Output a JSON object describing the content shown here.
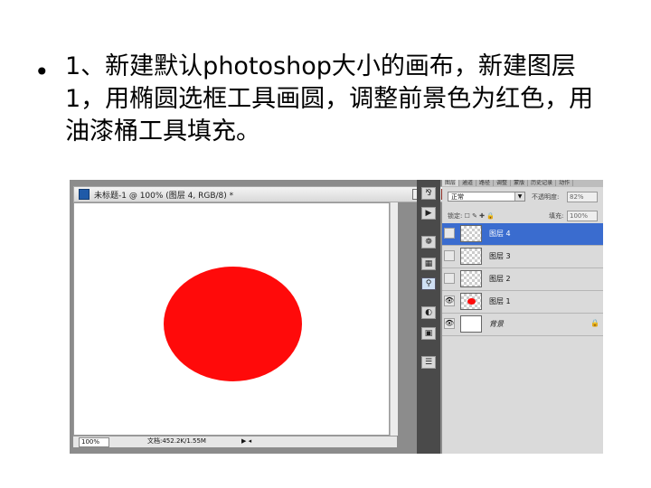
{
  "slide": {
    "bullet_char": "•",
    "text": "1、新建默认photoshop大小的画布，新建图层1，用椭圆选框工具画圆，调整前景色为红色，用油漆桶工具填充。"
  },
  "document_window": {
    "title": "未标题-1 @ 100% (图层 4, RGB/8) *",
    "buttons": {
      "minimize": "–",
      "maximize": "□",
      "close": "✕"
    },
    "zoom": "100%",
    "doc_info": "文档:452.2K/1.55M",
    "play": "▶ ◂",
    "ellipse_color": "#ff0a0a"
  },
  "dock": {
    "icons": [
      "history-icon",
      "actions-icon",
      "swatches-icon",
      "styles-icon",
      "layers-icon",
      "paths-icon",
      "navigator-icon",
      "channels-icon"
    ],
    "glyphs": [
      "⅋",
      "▶",
      "❁",
      "▦",
      "⚲",
      "◐",
      "▣",
      "☰"
    ]
  },
  "layers_panel": {
    "tabs": [
      "图层",
      "通道",
      "路径",
      "调整",
      "蒙版",
      "历史记录",
      "动作"
    ],
    "blend_mode": "正常",
    "opacity_label": "不透明度:",
    "opacity_value": "82%",
    "lock_label": "锁定: ☐ ✎ ✚ 🔒",
    "fill_label": "填充:",
    "fill_value": "100%",
    "layers": [
      {
        "name": "图层 4",
        "selected": true,
        "visible": false,
        "thumb": "transparent"
      },
      {
        "name": "图层 3",
        "selected": false,
        "visible": false,
        "thumb": "transparent"
      },
      {
        "name": "图层 2",
        "selected": false,
        "visible": false,
        "thumb": "transparent"
      },
      {
        "name": "图层 1",
        "selected": false,
        "visible": true,
        "thumb": "red-dot"
      },
      {
        "name": "背景",
        "selected": false,
        "visible": true,
        "thumb": "white",
        "locked": true
      }
    ],
    "eye_glyph": "👁",
    "lock_glyph": "🔒"
  }
}
